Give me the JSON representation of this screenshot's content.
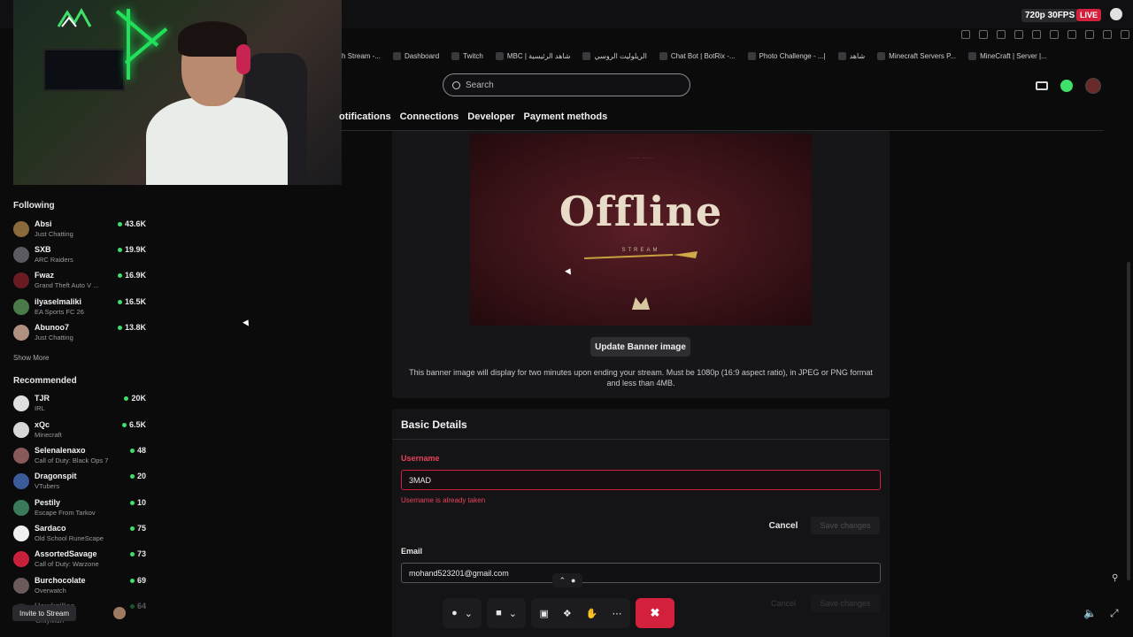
{
  "stream_overlay": {
    "quality": "720p 30FPS",
    "live_badge": "LIVE"
  },
  "bookmarks": [
    {
      "label": "h Stream -..."
    },
    {
      "label": "Dashboard"
    },
    {
      "label": "Twitch"
    },
    {
      "label": "MBC | شاهد الرئيسية"
    },
    {
      "label": "الريلوليت الروسي"
    },
    {
      "label": "Chat Bot | BotRix -..."
    },
    {
      "label": "Photo Challenge - ...| "
    },
    {
      "label": "شاهد"
    },
    {
      "label": "Minecraft Servers P..."
    },
    {
      "label": "MineCraft | Server |..."
    }
  ],
  "search": {
    "placeholder": "Search"
  },
  "tabs": [
    {
      "label": "otifications"
    },
    {
      "label": "Connections"
    },
    {
      "label": "Developer"
    },
    {
      "label": "Payment methods"
    }
  ],
  "sidebar": {
    "following_title": "Following",
    "following": [
      {
        "name": "Absi",
        "game": "Just Chatting",
        "viewers": "43.6K",
        "color": "#8a6a3a"
      },
      {
        "name": "SXB",
        "game": "ARC Raiders",
        "viewers": "19.9K",
        "color": "#5a5a60"
      },
      {
        "name": "Fwaz",
        "game": "Grand Theft Auto V ...",
        "viewers": "16.9K",
        "color": "#6a1a22"
      },
      {
        "name": "ilyaselmaliki",
        "game": "EA Sports FC 26",
        "viewers": "16.5K",
        "color": "#4a7a4a"
      },
      {
        "name": "Abunoo7",
        "game": "Just Chatting",
        "viewers": "13.8K",
        "color": "#b09080"
      }
    ],
    "show_more": "Show More",
    "recommended_title": "Recommended",
    "recommended": [
      {
        "name": "TJR",
        "game": "IRL",
        "viewers": "20K",
        "color": "#e0e0e0"
      },
      {
        "name": "xQc",
        "game": "Minecraft",
        "viewers": "6.5K",
        "color": "#d8d8d8"
      },
      {
        "name": "Selenalenaxo",
        "game": "Call of Duty: Black Ops 7",
        "viewers": "48",
        "color": "#8a5a5a"
      },
      {
        "name": "Dragonspit",
        "game": "VTubers",
        "viewers": "20",
        "color": "#3a5a9a"
      },
      {
        "name": "Pestily",
        "game": "Escape From Tarkov",
        "viewers": "10",
        "color": "#3a7a5a"
      },
      {
        "name": "Sardaco",
        "game": "Old School RuneScape",
        "viewers": "75",
        "color": "#f0f0f0"
      },
      {
        "name": "AssortedSavage",
        "game": "Call of Duty: Warzone",
        "viewers": "73",
        "color": "#c8203a"
      },
      {
        "name": "Burchocolate",
        "game": "Overwatch",
        "viewers": "69",
        "color": "#6a5a5a"
      },
      {
        "name": "Hawkzilles",
        "game": "",
        "viewers": "64",
        "color": "#5a5a60"
      }
    ]
  },
  "banner": {
    "image_title": "Offline",
    "image_subtitle": "STREAM",
    "update_button": "Update Banner image",
    "description": "This banner image will display for two minutes upon ending your stream. Must be 1080p (16:9 aspect ratio), in JPEG or PNG format and less than 4MB."
  },
  "basic_details": {
    "title": "Basic Details",
    "username_label": "Username",
    "username_value": "3MAD",
    "username_error": "Username is already taken",
    "cancel": "Cancel",
    "save": "Save changes",
    "email_label": "Email",
    "email_value": "mohand523201@gmail.com",
    "cancel2": "Cancel",
    "save2": "Save changes"
  },
  "footer": {
    "invite": "Invite to Stream",
    "bottom_name": "OnlyMuh"
  },
  "colors": {
    "live": "#d3203c",
    "online_dot": "#3ee06a",
    "error": "#e8445c",
    "end_call": "#d3203c"
  }
}
